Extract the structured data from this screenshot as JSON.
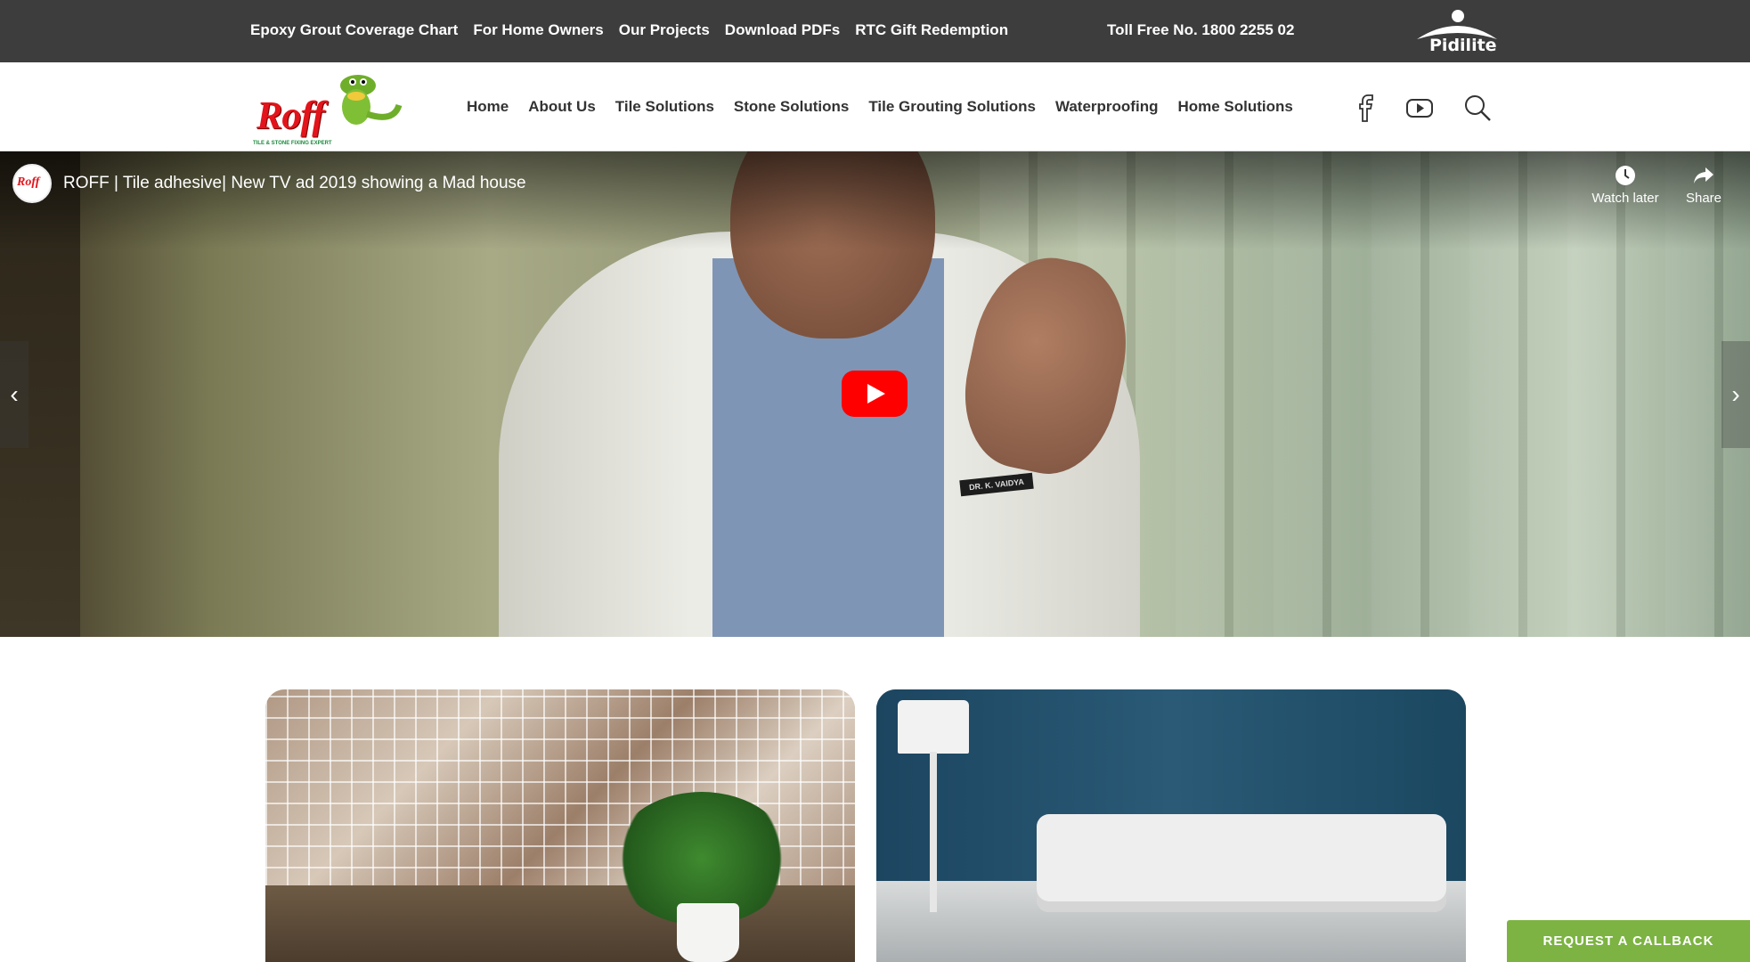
{
  "topbar": {
    "links": [
      {
        "label": "Epoxy Grout Coverage Chart"
      },
      {
        "label": "For Home Owners"
      },
      {
        "label": "Our Projects"
      },
      {
        "label": "Download PDFs"
      },
      {
        "label": "RTC Gift Redemption"
      }
    ],
    "toll_free": "Toll Free No. 1800 2255 02",
    "brand": "Pidilite"
  },
  "header": {
    "logo_text": "Roff",
    "logo_tagline": "TILE & STONE FIXING EXPERT",
    "nav": [
      {
        "label": "Home"
      },
      {
        "label": "About Us"
      },
      {
        "label": "Tile Solutions"
      },
      {
        "label": "Stone Solutions"
      },
      {
        "label": "Tile Grouting Solutions"
      },
      {
        "label": "Waterproofing"
      },
      {
        "label": "Home Solutions"
      }
    ],
    "icons": [
      "facebook-icon",
      "youtube-icon",
      "search-icon"
    ]
  },
  "video": {
    "channel_avatar_text": "Roff",
    "title": "ROFF | Tile adhesive| New TV ad 2019 showing a Mad house",
    "watch_later": "Watch later",
    "share": "Share",
    "badge_text": "DR. K. VAIDYA",
    "prev_arrow": "‹",
    "next_arrow": "›"
  },
  "cta": {
    "callback": "REQUEST A CALLBACK"
  },
  "colors": {
    "topbar_bg": "#3d3d3d",
    "brand_red": "#e3141b",
    "callback_green": "#7cb342",
    "youtube_red": "#ff0000"
  }
}
